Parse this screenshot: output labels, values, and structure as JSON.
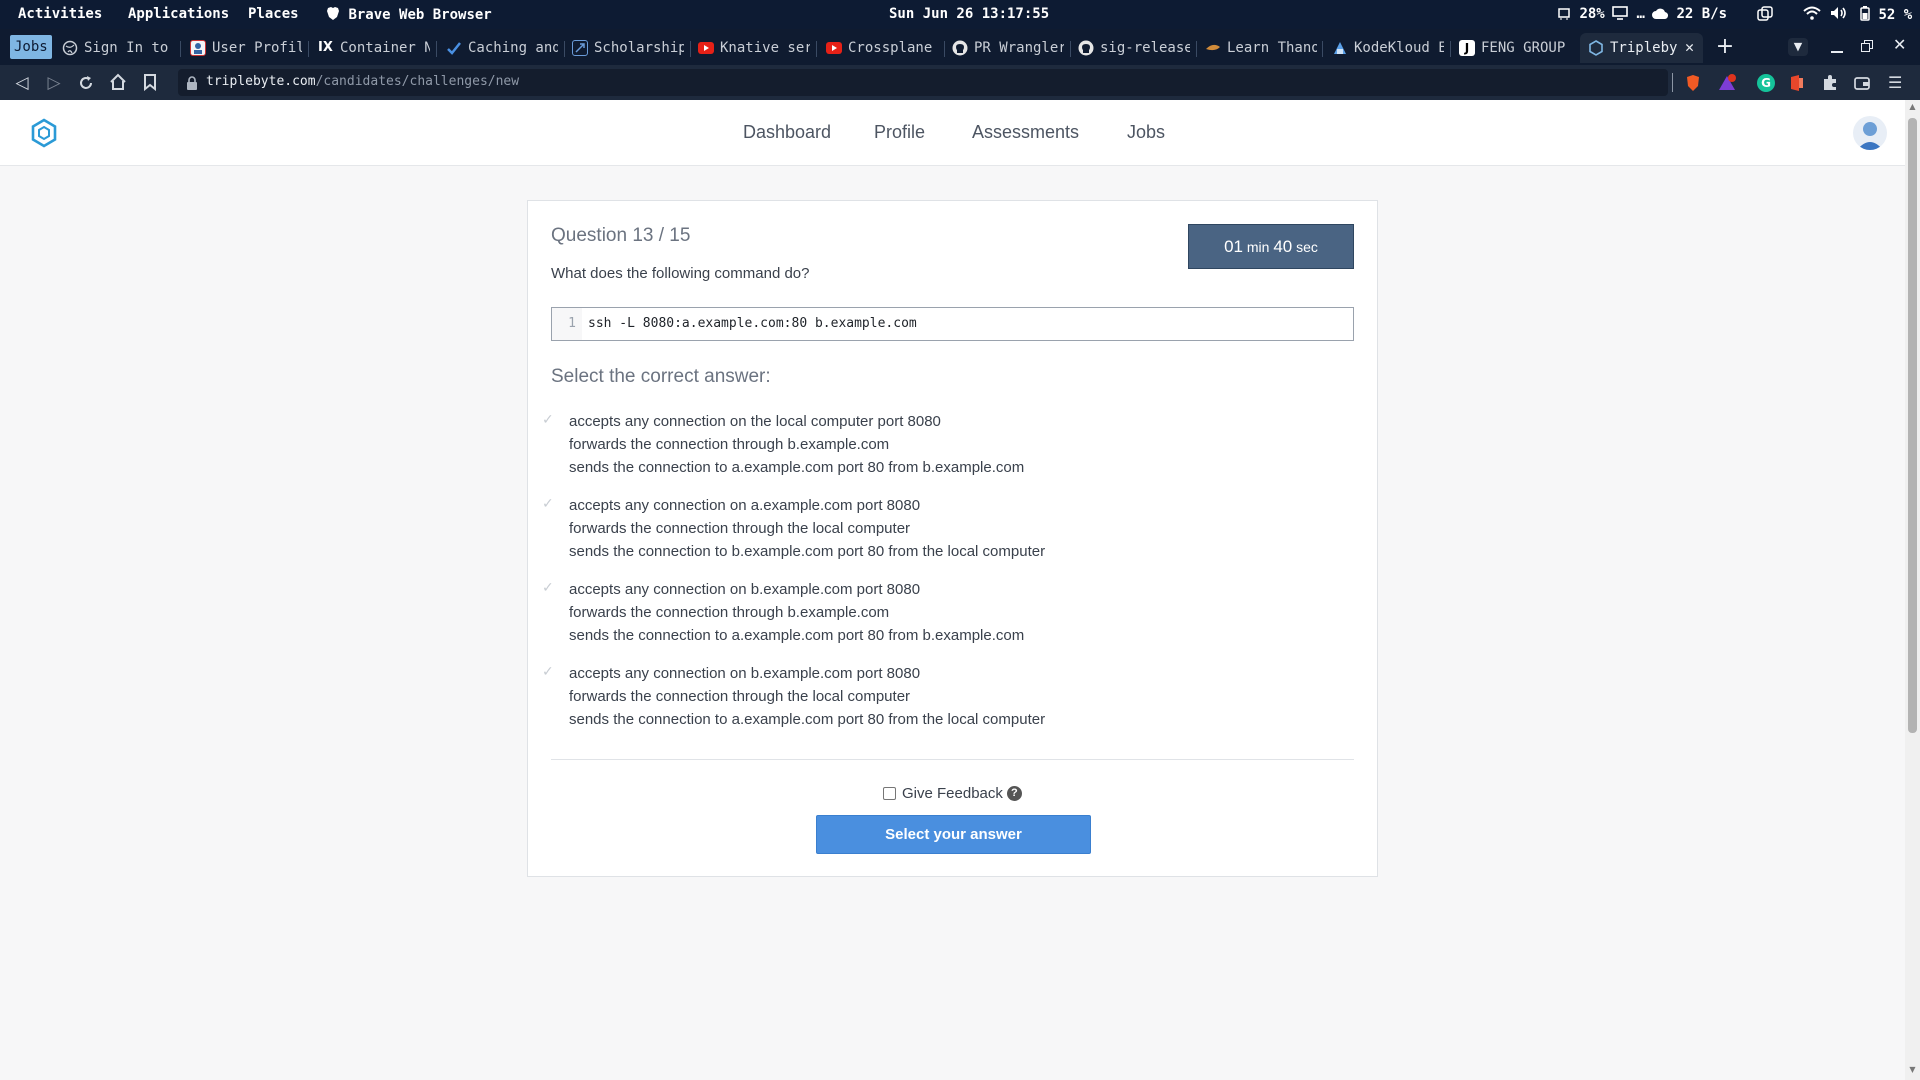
{
  "system_bar": {
    "activities": "Activities",
    "applications": "Applications",
    "places": "Places",
    "app_name": "Brave Web Browser",
    "clock": "Sun Jun 26  13:17:55",
    "cpu": "28%",
    "net_monitor": "…",
    "net_speed": "22 B/s",
    "battery": "52 %"
  },
  "tabs": [
    {
      "label": "Sign In to",
      "icon": "globe-icon"
    },
    {
      "label": "User Profil",
      "icon": "profile-icon"
    },
    {
      "label": "Container N",
      "icon": "ix-icon"
    },
    {
      "label": "Caching and",
      "icon": "check-icon"
    },
    {
      "label": "Scholarship",
      "icon": "link-icon"
    },
    {
      "label": "Knative ser",
      "icon": "youtube-icon"
    },
    {
      "label": "Crossplane",
      "icon": "youtube-icon"
    },
    {
      "label": "PR Wrangler",
      "icon": "github-icon"
    },
    {
      "label": "sig-release",
      "icon": "github-icon"
    },
    {
      "label": "Learn Thano",
      "icon": "thanos-icon"
    },
    {
      "label": "KodeKloud E",
      "icon": "kodekloud-icon"
    },
    {
      "label": "FENG GROUP",
      "icon": "j-icon"
    },
    {
      "label": "Tripleby",
      "icon": "triplebyte-icon"
    }
  ],
  "workspace_tab": "Jobs",
  "address": {
    "domain": "triplebyte.com",
    "path": "/candidates/challenges/new"
  },
  "nav": {
    "dashboard": "Dashboard",
    "profile": "Profile",
    "assessments": "Assessments",
    "jobs": "Jobs"
  },
  "question": {
    "number": "Question 13 / 15",
    "prompt": "What does the following command do?",
    "timer_min": "01",
    "timer_min_unit": " min ",
    "timer_sec": "40",
    "timer_sec_unit": " sec",
    "code_line_number": "1",
    "code": "ssh -L 8080:a.example.com:80 b.example.com",
    "select_heading": "Select the correct answer:",
    "options": [
      {
        "line1": "accepts any connection on the local computer port 8080",
        "line2": "forwards the connection through b.example.com",
        "line3": "sends the connection to a.example.com port 80 from b.example.com"
      },
      {
        "line1": "accepts any connection on a.example.com port 8080",
        "line2": "forwards the connection through the local computer",
        "line3": "sends the connection to b.example.com port 80 from the local computer"
      },
      {
        "line1": "accepts any connection on b.example.com port 8080",
        "line2": "forwards the connection through b.example.com",
        "line3": "sends the connection to a.example.com port 80 from b.example.com"
      },
      {
        "line1": "accepts any connection on b.example.com port 8080",
        "line2": "forwards the connection through the local computer",
        "line3": "sends the connection to a.example.com port 80 from the local computer"
      }
    ],
    "feedback_label": "Give Feedback",
    "submit_label": "Select your answer"
  },
  "colors": {
    "topbar": "#0d1b33",
    "tabstrip": "#0f1b30",
    "urlbar": "#1e2a3d",
    "timer_bg": "#4a6483",
    "primary_button": "#4a8fdf",
    "logo": "#2b9ad6"
  }
}
